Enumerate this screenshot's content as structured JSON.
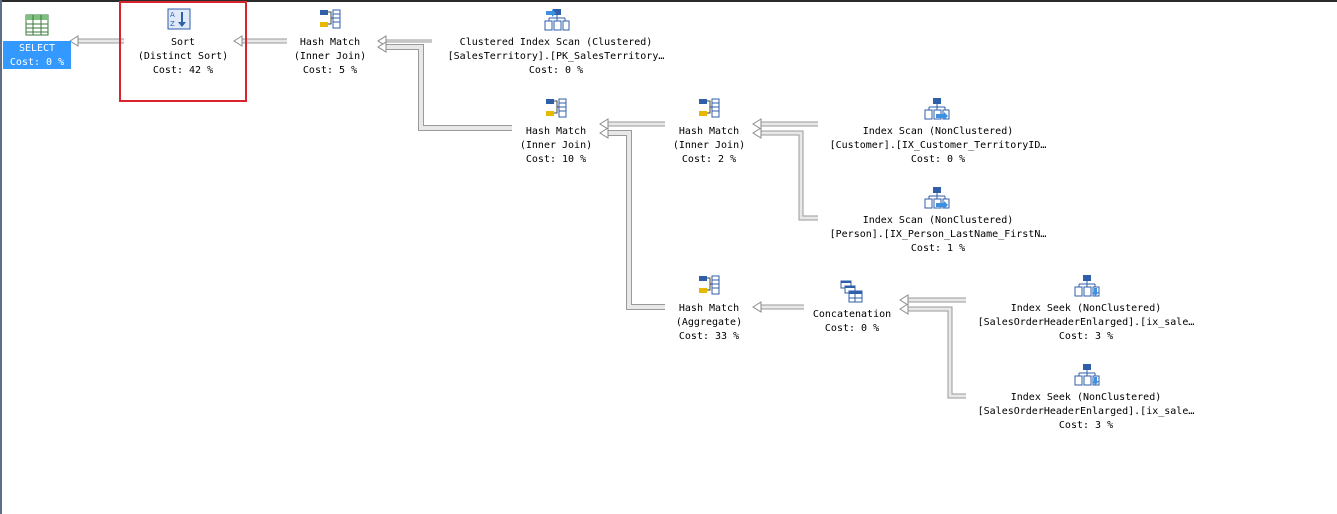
{
  "colors": {
    "selection": "#3399ff",
    "highlight": "#d9232d",
    "arrow": "#b9b9b9"
  },
  "nodes": {
    "select": {
      "icon": "result-grid-icon",
      "title": "SELECT",
      "cost": "Cost: 0 %"
    },
    "sort": {
      "icon": "sort-icon",
      "title": "Sort",
      "sub": "(Distinct Sort)",
      "cost": "Cost: 42 %"
    },
    "hash1": {
      "icon": "hash-match-icon",
      "title": "Hash Match",
      "sub": "(Inner Join)",
      "cost": "Cost: 5 %"
    },
    "cis": {
      "icon": "clustered-index-scan-icon",
      "title": "Clustered Index Scan (Clustered)",
      "sub": "[SalesTerritory].[PK_SalesTerritory…",
      "cost": "Cost: 0 %"
    },
    "hash2": {
      "icon": "hash-match-icon",
      "title": "Hash Match",
      "sub": "(Inner Join)",
      "cost": "Cost: 10 %"
    },
    "hash3": {
      "icon": "hash-match-icon",
      "title": "Hash Match",
      "sub": "(Inner Join)",
      "cost": "Cost: 2 %"
    },
    "is1": {
      "icon": "index-scan-icon",
      "title": "Index Scan (NonClustered)",
      "sub": "[Customer].[IX_Customer_TerritoryID…",
      "cost": "Cost: 0 %"
    },
    "is2": {
      "icon": "index-scan-icon",
      "title": "Index Scan (NonClustered)",
      "sub": "[Person].[IX_Person_LastName_FirstN…",
      "cost": "Cost: 1 %"
    },
    "hash4": {
      "icon": "hash-match-icon",
      "title": "Hash Match",
      "sub": "(Aggregate)",
      "cost": "Cost: 33 %"
    },
    "concat": {
      "icon": "concatenation-icon",
      "title": "Concatenation",
      "cost": "Cost: 0 %"
    },
    "seek1": {
      "icon": "index-seek-icon",
      "title": "Index Seek (NonClustered)",
      "sub": "[SalesOrderHeaderEnlarged].[ix_sale…",
      "cost": "Cost: 3 %"
    },
    "seek2": {
      "icon": "index-seek-icon",
      "title": "Index Seek (NonClustered)",
      "sub": "[SalesOrderHeaderEnlarged].[ix_sale…",
      "cost": "Cost: 3 %"
    }
  }
}
